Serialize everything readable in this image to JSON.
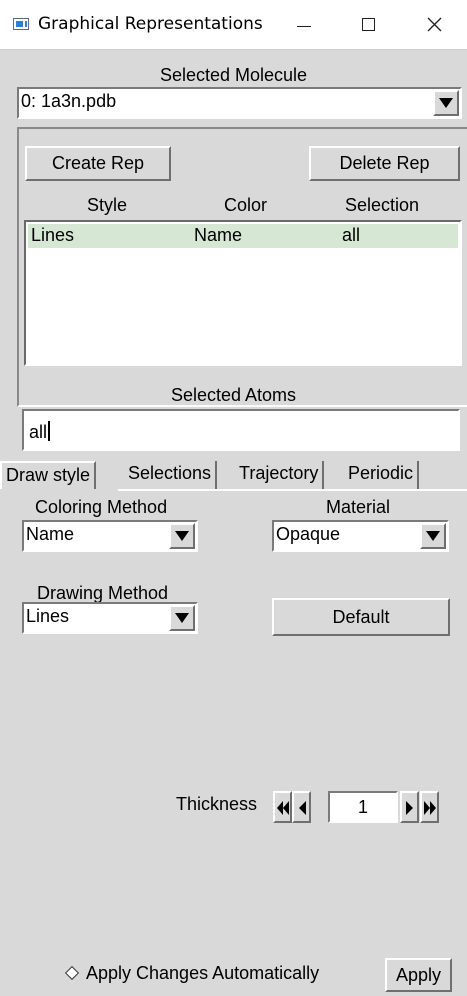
{
  "window": {
    "title": "Graphical Representations",
    "icon": "app-window-icon",
    "controls": [
      "minimize-icon",
      "maximize-icon",
      "close-icon"
    ]
  },
  "molecule": {
    "label": "Selected Molecule",
    "selected": "0: 1a3n.pdb"
  },
  "reps": {
    "create_label": "Create Rep",
    "delete_label": "Delete Rep",
    "columns": [
      "Style",
      "Color",
      "Selection"
    ],
    "rows": [
      {
        "style": "Lines",
        "color": "Name",
        "selection": "all"
      }
    ],
    "selected_row_color": "#d6e8d4"
  },
  "atoms": {
    "label": "Selected Atoms",
    "value": "all"
  },
  "tabs": [
    {
      "label": "Draw style",
      "active": true
    },
    {
      "label": "Selections",
      "active": false
    },
    {
      "label": "Trajectory",
      "active": false
    },
    {
      "label": "Periodic",
      "active": false
    }
  ],
  "draw": {
    "coloring_label": "Coloring Method",
    "coloring_value": "Name",
    "material_label": "Material",
    "material_value": "Opaque",
    "drawing_label": "Drawing Method",
    "drawing_value": "Lines",
    "default_label": "Default",
    "thickness_label": "Thickness",
    "thickness_value": "1"
  },
  "bottom": {
    "auto_apply_label": "Apply Changes Automatically",
    "apply_label": "Apply"
  },
  "colors": {
    "background": "#d9d9d9",
    "titlebar": "#ffffff",
    "list_background": "#ffffff"
  }
}
